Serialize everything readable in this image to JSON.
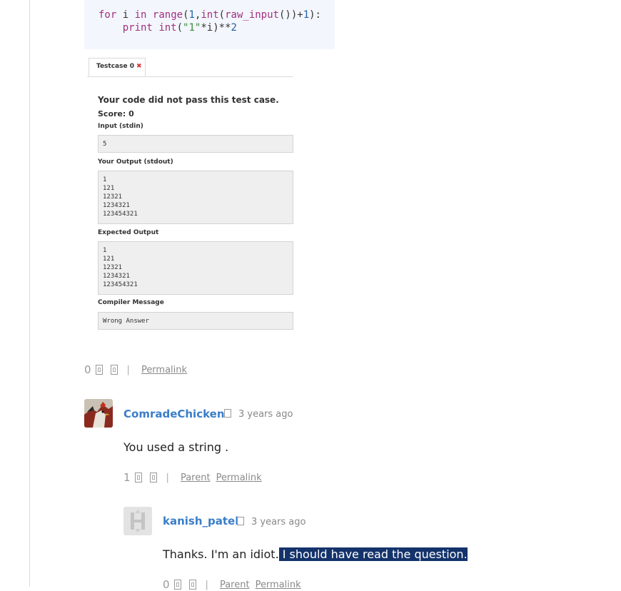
{
  "code": {
    "line1": {
      "kw_for": "for",
      "var_i": "i",
      "kw_in": "in",
      "fn_range": "range",
      "num_1": "1",
      "fn_int": "int",
      "fn_raw_input": "raw_input",
      "num_plus1": "1"
    },
    "line2": {
      "kw_print": "print",
      "fn_int": "int",
      "str_1": "\"1\"",
      "var_i": "i",
      "num_2": "2"
    }
  },
  "testcase": {
    "tab_label": "Testcase 0",
    "tab_close": "✖",
    "title": "Your code did not pass this test case.",
    "score": "Score: 0",
    "input_label": "Input (stdin)",
    "input_value": "5",
    "output_label": "Your Output (stdout)",
    "output_value": "1\n121\n12321\n1234321\n123454321",
    "expected_label": "Expected Output",
    "expected_value": "1\n121\n12321\n1234321\n123454321",
    "compiler_label": "Compiler Message",
    "compiler_value": "Wrong Answer"
  },
  "post_votes": {
    "count": "0",
    "separator": "|",
    "permalink": "Permalink"
  },
  "comments": [
    {
      "author": "ComradeChicken",
      "time_ago": "3 years ago",
      "body": "You used a string .",
      "votes": {
        "count": "1",
        "separator": "|",
        "parent": "Parent",
        "permalink": "Permalink"
      }
    },
    {
      "author": "kanish_patel",
      "time_ago": "3 years ago",
      "body_plain": "Thanks. I'm an idiot.",
      "body_selected": " I should have read the question.",
      "votes": {
        "count": "0",
        "separator": "|",
        "parent": "Parent",
        "permalink": "Permalink"
      }
    }
  ],
  "colors": {
    "link_blue": "#3a7dc9",
    "selection": "#14336b",
    "code_bg": "#f3f6fc"
  },
  "icons": [
    "upvote-icon",
    "downvote-icon",
    "flag-icon",
    "close-icon"
  ]
}
